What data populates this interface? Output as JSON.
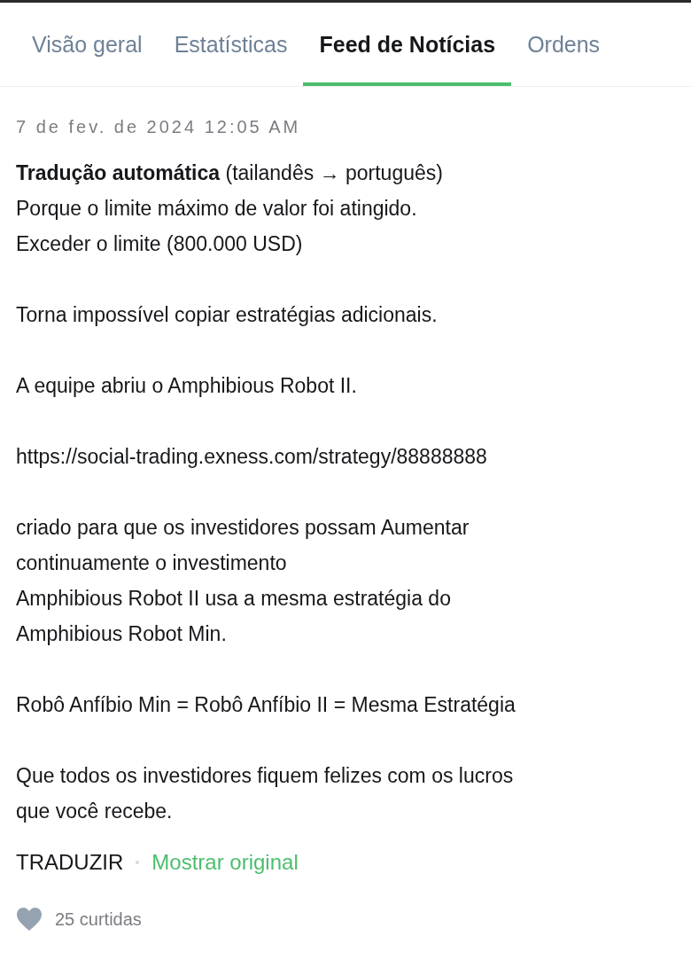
{
  "tabs": [
    {
      "label": "Visão geral",
      "selected": false
    },
    {
      "label": "Estatísticas",
      "selected": false
    },
    {
      "label": "Feed de Notícias",
      "selected": true
    },
    {
      "label": "Ordens",
      "selected": false
    }
  ],
  "post": {
    "date": "7 de fev. de 2024 12:05 AM",
    "paragraphs": [
      [
        "**Tradução automática** (tailandês → português)",
        "Porque o limite máximo de valor foi atingido.",
        "Exceder o limite (800.000 USD)"
      ],
      [
        "Torna impossível copiar estratégias adicionais."
      ],
      [
        "A equipe abriu o Amphibious Robot II."
      ],
      [
        "https://social-trading.exness.com/strategy/88888888"
      ],
      [
        "criado para que os investidores possam Aumentar",
        "continuamente o investimento",
        "Amphibious Robot II usa a mesma estratégia do",
        "Amphibious Robot Min."
      ],
      [
        "Robô Anfíbio Min = Robô Anfíbio II = Mesma Estratégia"
      ],
      [
        "Que todos os investidores fiquem felizes com os lucros",
        "que você recebe."
      ]
    ],
    "actions": [
      {
        "label": "TRADUZIR",
        "selected": false
      },
      {
        "label": "Mostrar original",
        "selected": true
      }
    ],
    "likes": {
      "liked": false,
      "count": "25 curtidas"
    }
  }
}
